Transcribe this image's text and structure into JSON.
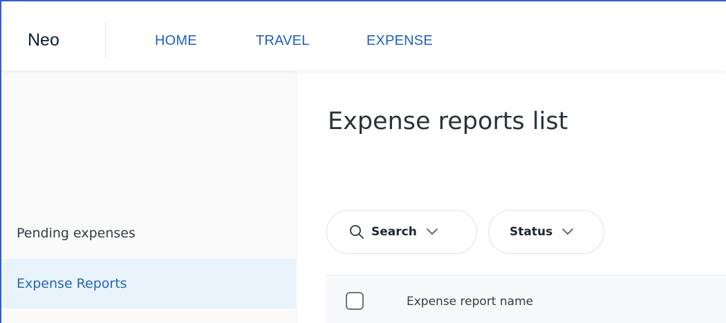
{
  "app": {
    "brand": "Neo"
  },
  "nav": {
    "home": "HOME",
    "travel": "TRAVEL",
    "expense": "EXPENSE"
  },
  "sidebar": {
    "items": [
      {
        "label": "Pending expenses",
        "active": false
      },
      {
        "label": "Expense Reports",
        "active": true
      }
    ]
  },
  "main": {
    "title": "Expense reports list",
    "filters": {
      "search_label": "Search",
      "status_label": "Status"
    },
    "table": {
      "columns": [
        "Expense report name"
      ]
    }
  },
  "colors": {
    "accent": "#1d5fc3",
    "active_bg": "#e8f3fc",
    "frame_border": "#2f5fc4"
  },
  "icons": {
    "search": "search-icon",
    "chevron": "chevron-down-icon"
  }
}
